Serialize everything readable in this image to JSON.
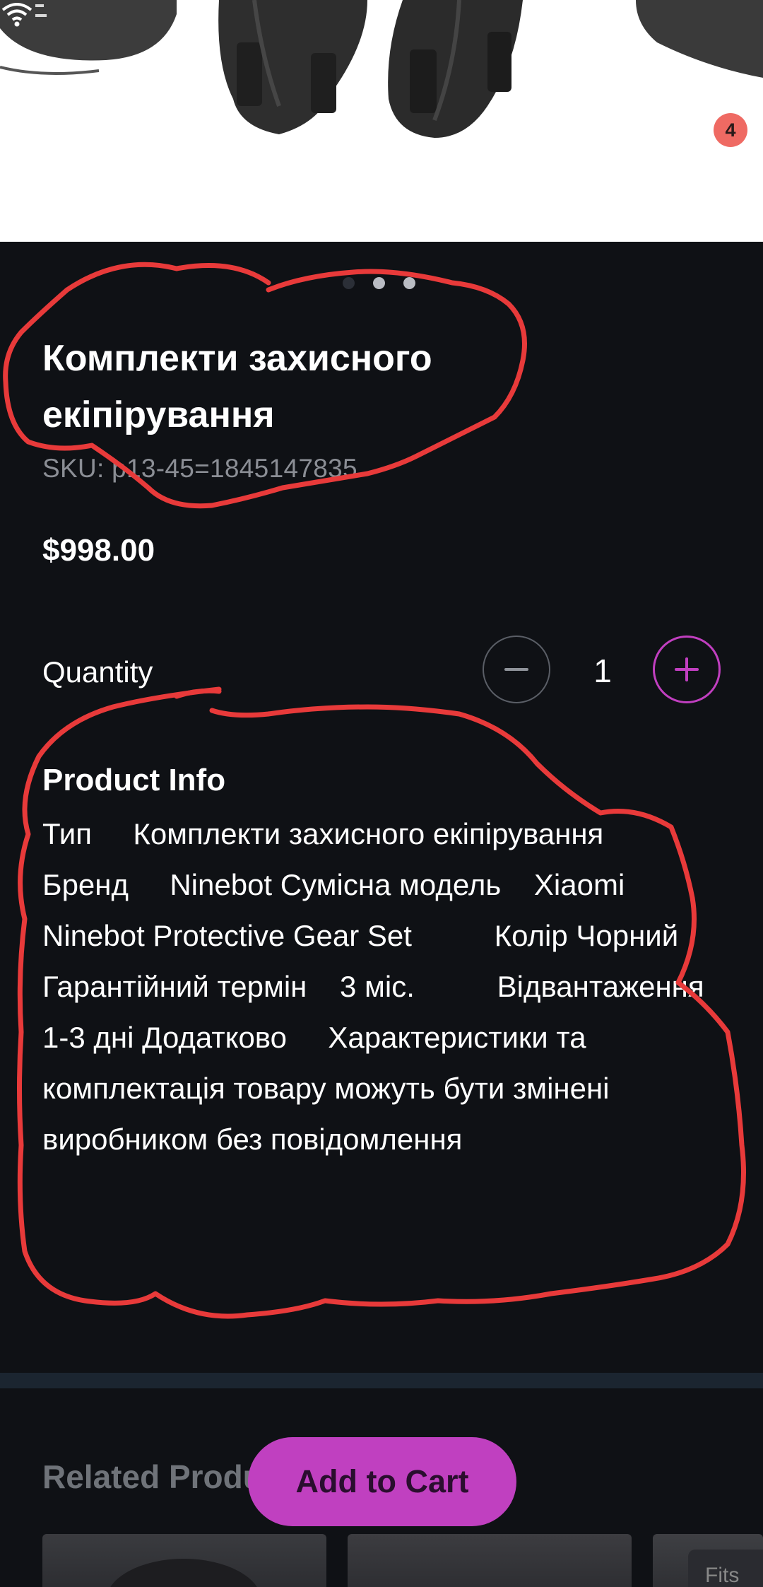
{
  "hero": {
    "badge_count": "4",
    "wifi_icon": "wifi-icon"
  },
  "gallery": {
    "dots": 3,
    "active_index": 0
  },
  "product": {
    "title": "Комплекти захисного екіпірування",
    "sku": "SKU: p13-45=1845147835",
    "price": "$998.00"
  },
  "quantity": {
    "label": "Quantity",
    "value": "1",
    "minus_icon": "minus-icon",
    "plus_icon": "plus-icon"
  },
  "product_info": {
    "title": "Product Info",
    "body": "Тип     Комплекти захисного екіпірування          Бренд     Ninebot Сумісна модель    Xiaomi Ninebot Protective Gear Set          Колір Чорний          Гарантійний термін    3 міс.          Відвантаження    1-3 дні Додатково     Характеристики та комплектація товару можуть бути змінені виробником без повідомлення"
  },
  "related": {
    "title": "Related Products",
    "card_chip": "Fits"
  },
  "cta": {
    "add_to_cart": "Add to Cart"
  },
  "colors": {
    "accent": "#c040c0",
    "background": "#0f1115",
    "badge": "#ef6a63",
    "annotation": "#e83a3a"
  }
}
